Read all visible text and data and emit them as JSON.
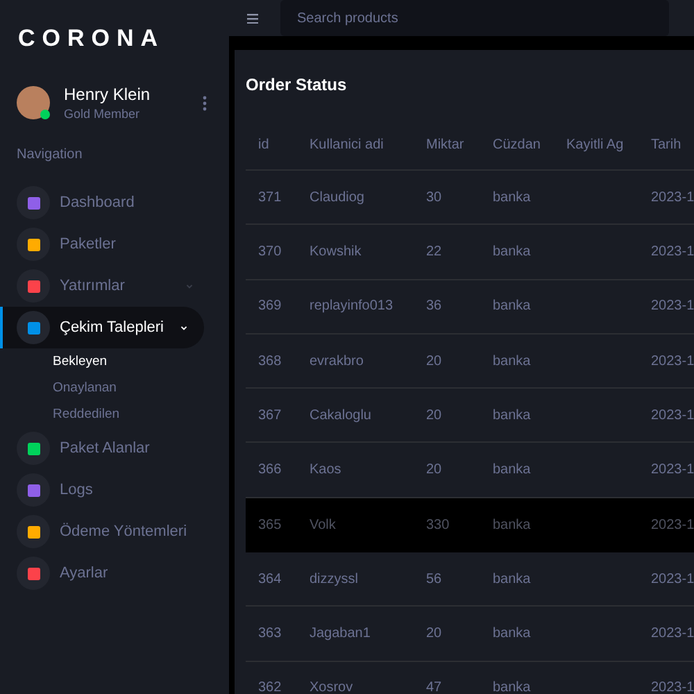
{
  "brand": "CORONA",
  "profile": {
    "name": "Henry Klein",
    "role": "Gold Member",
    "online": true
  },
  "navigation_heading": "Navigation",
  "menu": [
    {
      "label": "Dashboard",
      "color": "#8f5fe8",
      "selected": false,
      "expandable": false
    },
    {
      "label": "Paketler",
      "color": "#ffab00",
      "selected": false,
      "expandable": false
    },
    {
      "label": "Yatırımlar",
      "color": "#fc424a",
      "selected": false,
      "expandable": true
    },
    {
      "label": "Çekim Talepleri",
      "color": "#0090e7",
      "selected": true,
      "expandable": true,
      "children": [
        {
          "label": "Bekleyen",
          "selected": true
        },
        {
          "label": "Onaylanan",
          "selected": false
        },
        {
          "label": "Reddedilen",
          "selected": false
        }
      ]
    },
    {
      "label": "Paket Alanlar",
      "color": "#00d25b",
      "selected": false,
      "expandable": false
    },
    {
      "label": "Logs",
      "color": "#8f5fe8",
      "selected": false,
      "expandable": false
    },
    {
      "label": "Ödeme Yöntemleri",
      "color": "#ffab00",
      "selected": false,
      "expandable": false
    },
    {
      "label": "Ayarlar",
      "color": "#fc424a",
      "selected": false,
      "expandable": false
    }
  ],
  "search": {
    "placeholder": "Search products"
  },
  "card_title": "Order Status",
  "table": {
    "columns": [
      "id",
      "Kullanici adi",
      "Miktar",
      "Cüzdan",
      "Kayitli Ag",
      "Tarih"
    ],
    "rows": [
      {
        "cells": [
          "371",
          "Claudiog",
          "30",
          "banka",
          "",
          "2023-1"
        ],
        "selected": false
      },
      {
        "cells": [
          "370",
          "Kowshik",
          "22",
          "banka",
          "",
          "2023-1"
        ],
        "selected": false
      },
      {
        "cells": [
          "369",
          "replayinfo013",
          "36",
          "banka",
          "",
          "2023-1"
        ],
        "selected": false
      },
      {
        "cells": [
          "368",
          "evrakbro",
          "20",
          "banka",
          "",
          "2023-1"
        ],
        "selected": false
      },
      {
        "cells": [
          "367",
          "Cakaloglu",
          "20",
          "banka",
          "",
          "2023-1"
        ],
        "selected": false
      },
      {
        "cells": [
          "366",
          "Kaos",
          "20",
          "banka",
          "",
          "2023-1"
        ],
        "selected": false
      },
      {
        "cells": [
          "365",
          "Volk",
          "330",
          "banka",
          "",
          "2023-1"
        ],
        "selected": true
      },
      {
        "cells": [
          "364",
          "dizzyssl",
          "56",
          "banka",
          "",
          "2023-1"
        ],
        "selected": false
      },
      {
        "cells": [
          "363",
          "Jagaban1",
          "20",
          "banka",
          "",
          "2023-1"
        ],
        "selected": false
      },
      {
        "cells": [
          "362",
          "Xosrov",
          "47",
          "banka",
          "",
          "2023-1"
        ],
        "selected": false
      }
    ]
  }
}
